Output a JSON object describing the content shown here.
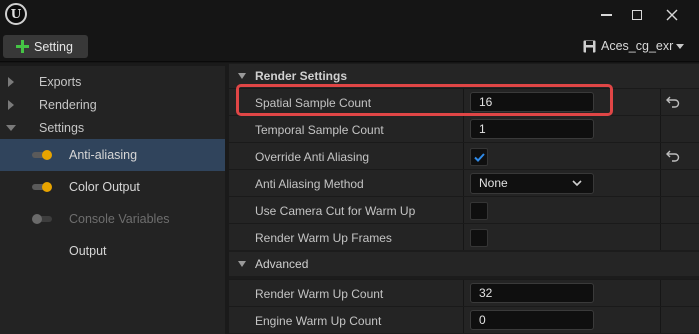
{
  "window": {
    "controls": {
      "minimize_icon": "minimize-icon",
      "maximize_icon": "maximize-icon",
      "close_icon": "close-icon"
    }
  },
  "toolbar": {
    "setting_label": "Setting",
    "preset_label": "Aces_cg_exr",
    "accent_add": "#45c445"
  },
  "sidebar": {
    "groups": [
      {
        "label": "Exports",
        "expanded": false
      },
      {
        "label": "Rendering",
        "expanded": false
      },
      {
        "label": "Settings",
        "expanded": true
      }
    ],
    "items": [
      {
        "label": "Anti-aliasing",
        "toggle": "on",
        "selected": true
      },
      {
        "label": "Color Output",
        "toggle": "on",
        "selected": false
      },
      {
        "label": "Console Variables",
        "toggle": "off",
        "selected": false
      },
      {
        "label": "Output",
        "toggle": "none",
        "selected": false
      }
    ],
    "toggle_on_color": "#e8a400",
    "selected_color": "#30445c"
  },
  "details": {
    "categories": [
      {
        "label": "Render Settings"
      },
      {
        "label": "Advanced"
      }
    ],
    "render_settings": [
      {
        "name": "Spatial Sample Count",
        "type": "number",
        "value": "16",
        "resettable": true
      },
      {
        "name": "Temporal Sample Count",
        "type": "number",
        "value": "1",
        "resettable": false
      },
      {
        "name": "Override Anti Aliasing",
        "type": "checkbox",
        "checked": true,
        "resettable": true
      },
      {
        "name": "Anti Aliasing Method",
        "type": "dropdown",
        "value": "None",
        "resettable": false
      },
      {
        "name": "Use Camera Cut for Warm Up",
        "type": "checkbox",
        "checked": false,
        "resettable": false
      },
      {
        "name": "Render Warm Up Frames",
        "type": "checkbox",
        "checked": false,
        "resettable": false
      }
    ],
    "advanced": [
      {
        "name": "Render Warm Up Count",
        "type": "number",
        "value": "32"
      },
      {
        "name": "Engine Warm Up Count",
        "type": "number",
        "value": "0"
      }
    ],
    "highlight_color": "#e04646",
    "checkmark_color": "#2f8ae8"
  }
}
